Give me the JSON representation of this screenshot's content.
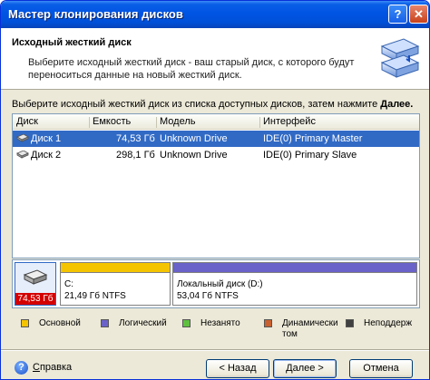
{
  "window": {
    "title": "Мастер клонирования дисков",
    "help_glyph": "?",
    "close_glyph": "✕"
  },
  "header": {
    "title": "Исходный жесткий диск",
    "description": "Выберите исходный жесткий диск - ваш старый диск, с которого будут переноситься данные на новый жесткий диск."
  },
  "instruction": {
    "text": "Выберите исходный жесткий диск из списка доступных дисков, затем нажмите ",
    "emphasis": "Далее."
  },
  "disk_list": {
    "columns": [
      "Диск",
      "Емкость",
      "Модель",
      "Интерфейс"
    ],
    "rows": [
      {
        "disk": "Диск 1",
        "capacity": "74,53 Гб",
        "model": "Unknown Drive",
        "interface": "IDE(0) Primary Master",
        "selected": true
      },
      {
        "disk": "Диск 2",
        "capacity": "298,1 Гб",
        "model": "Unknown Drive",
        "interface": "IDE(0) Primary Slave",
        "selected": false
      }
    ]
  },
  "disk_map": {
    "disk_size": "74,53 Гб",
    "partitions": [
      {
        "name": "C:",
        "size": "21,49 Гб",
        "fs": "NTFS",
        "type": "primary"
      },
      {
        "name": "Локальный диск (D:)",
        "size": "53,04 Гб",
        "fs": "NTFS",
        "type": "logical"
      }
    ]
  },
  "legend": [
    {
      "label": "Основной",
      "color": "#f5c400"
    },
    {
      "label": "Логический",
      "color": "#6a62c8"
    },
    {
      "label": "Незанято",
      "color": "#5fc040"
    },
    {
      "label": "Динамически\nтом",
      "color": "#c86030"
    },
    {
      "label": "Неподдерж",
      "color": "#404040"
    }
  ],
  "colors": {
    "primary_bar": "#f5c400",
    "logical_bar": "#6a62c8",
    "selection": "#316ac5",
    "titlebar": "#0054e3"
  },
  "footer": {
    "help_label": "Справка",
    "help_accel": "С",
    "back_label": "< Назад",
    "next_label": "Далее >",
    "cancel_label": "Отмена"
  }
}
